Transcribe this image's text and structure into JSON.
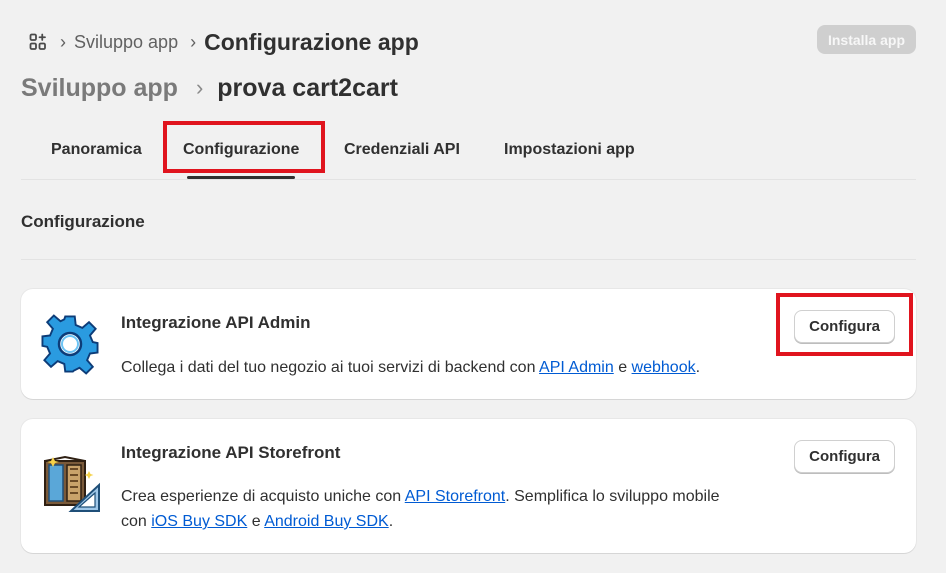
{
  "breadcrumb": {
    "parent": "Sviluppo app",
    "current": "Configurazione app"
  },
  "header": {
    "install_button": "Installa app",
    "parent": "Sviluppo app",
    "title": "prova cart2cart"
  },
  "tabs": [
    {
      "label": "Panoramica"
    },
    {
      "label": "Configurazione"
    },
    {
      "label": "Credenziali API"
    },
    {
      "label": "Impostazioni app"
    }
  ],
  "section": {
    "title": "Configurazione"
  },
  "cards": [
    {
      "title": "Integrazione API Admin",
      "icon": "gear-icon",
      "desc_pre": "Collega i dati del tuo negozio ai tuoi servizi di backend con ",
      "link1": "API Admin",
      "desc_mid": " e ",
      "link2": "webhook",
      "desc_post": ".",
      "button": "Configura"
    },
    {
      "title": "Integrazione API Storefront",
      "icon": "storefront-icon",
      "desc_pre": "Crea esperienze di acquisto uniche con ",
      "link1": "API Storefront",
      "desc_mid1": ". Semplifica lo sviluppo mobile con ",
      "link2": "iOS Buy SDK",
      "desc_mid2": " e ",
      "link3": "Android Buy SDK",
      "desc_post": ".",
      "button": "Configura"
    }
  ],
  "colors": {
    "highlight": "#e0141e",
    "link": "#005bd3",
    "background": "#f1f1f1"
  }
}
